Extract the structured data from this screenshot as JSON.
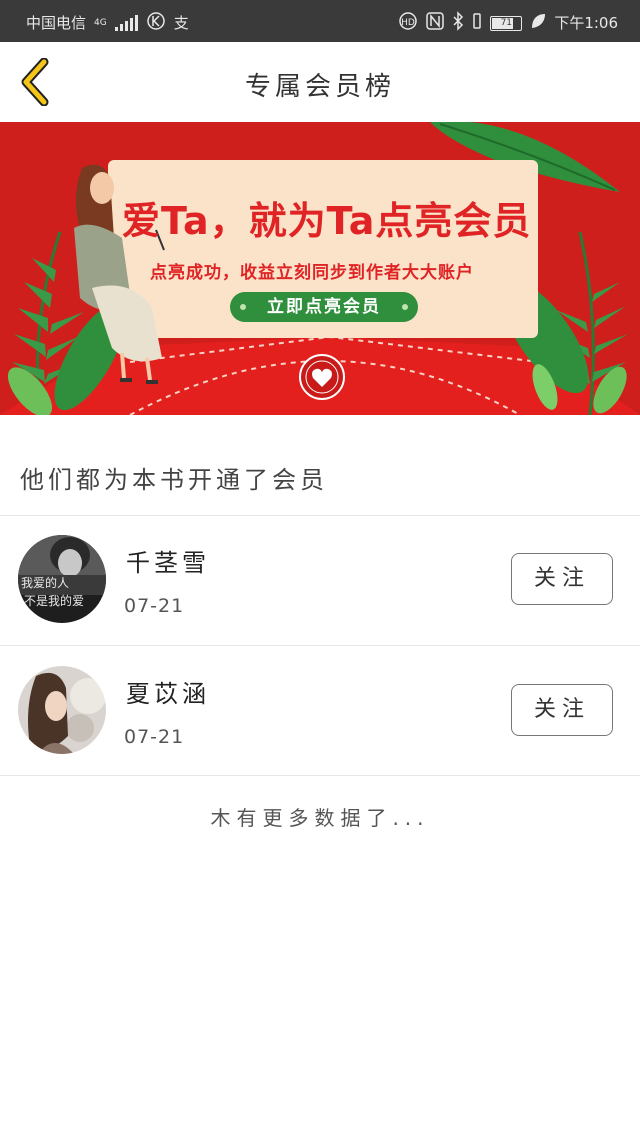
{
  "status_bar": {
    "carrier": "中国电信",
    "network": "4G",
    "time": "下午1:06",
    "battery_level": "71",
    "carrier_icons": [
      "signal-icon",
      "k-icon",
      "alipay-icon"
    ],
    "system_icons": [
      "hd-icon",
      "nfc-icon",
      "bluetooth-icon",
      "vibrate-icon",
      "battery-icon",
      "leaf-icon"
    ]
  },
  "header": {
    "title": "专属会员榜",
    "back_icon": "chevron-left-icon"
  },
  "banner": {
    "headline": "爱Ta，就为Ta点亮会员",
    "subline": "点亮成功，收益立刻同步到作者大大账户",
    "cta_label": "立即点亮会员",
    "colors": {
      "background": "#cf1f1c",
      "card": "#fbe3c9",
      "cta": "#2f8f3d",
      "leaf": "#3a9a48"
    }
  },
  "section": {
    "title": "他们都为本书开通了会员"
  },
  "members": [
    {
      "name": "千茎雪",
      "date": "07-21",
      "follow_label": "关注",
      "avatar_text_1": "我爱的人",
      "avatar_text_2": "不是我的爱"
    },
    {
      "name": "夏苡涵",
      "date": "07-21",
      "follow_label": "关注"
    }
  ],
  "footer": {
    "no_more_text": "木有更多数据了..."
  },
  "accent_color": "#f5c518"
}
